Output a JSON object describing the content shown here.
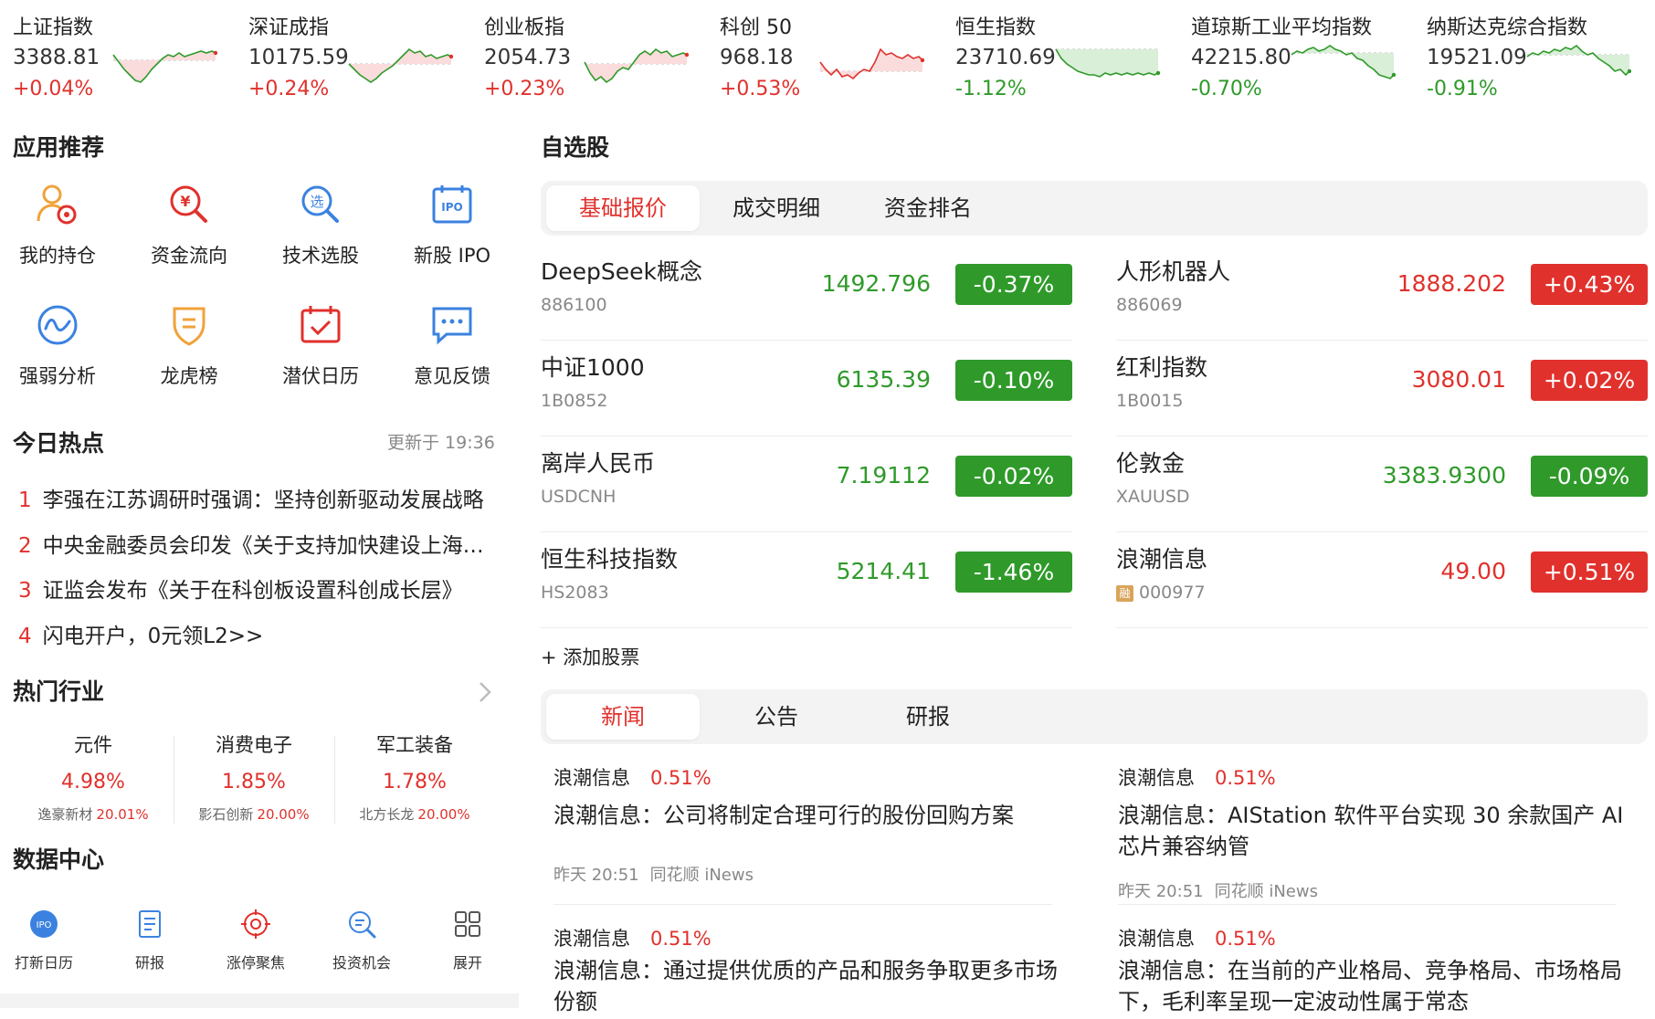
{
  "colors": {
    "up": "#e0312c",
    "down": "#2f9a2a"
  },
  "ticker": [
    {
      "name": "上证指数",
      "price": "3388.81",
      "change": "+0.04%",
      "dir": "up"
    },
    {
      "name": "深证成指",
      "price": "10175.59",
      "change": "+0.24%",
      "dir": "up"
    },
    {
      "name": "创业板指",
      "price": "2054.73",
      "change": "+0.23%",
      "dir": "up"
    },
    {
      "name": "科创 50",
      "price": "968.18",
      "change": "+0.53%",
      "dir": "up"
    },
    {
      "name": "恒生指数",
      "price": "23710.69",
      "change": "-1.12%",
      "dir": "down"
    },
    {
      "name": "道琼斯工业平均指数",
      "price": "42215.80",
      "change": "-0.70%",
      "dir": "down"
    },
    {
      "name": "纳斯达克综合指数",
      "price": "19521.09",
      "change": "-0.91%",
      "dir": "down"
    }
  ],
  "apps": {
    "title": "应用推荐",
    "items": [
      {
        "label": "我的持仓",
        "icon": "portfolio-icon"
      },
      {
        "label": "资金流向",
        "icon": "fund-flow-icon"
      },
      {
        "label": "技术选股",
        "icon": "stock-picker-icon"
      },
      {
        "label": "新股 IPO",
        "icon": "ipo-icon"
      },
      {
        "label": "强弱分析",
        "icon": "strength-analysis-icon"
      },
      {
        "label": "龙虎榜",
        "icon": "dragon-tiger-icon"
      },
      {
        "label": "潜伏日历",
        "icon": "calendar-icon"
      },
      {
        "label": "意见反馈",
        "icon": "feedback-icon"
      }
    ]
  },
  "hot_today": {
    "title": "今日热点",
    "updated": "更新于 19:36",
    "items": [
      {
        "num": "1",
        "text": "李强在江苏调研时强调：坚持创新驱动发展战略"
      },
      {
        "num": "2",
        "text": "中央金融委员会印发《关于支持加快建设上海国际金融中心》"
      },
      {
        "num": "3",
        "text": "证监会发布《关于在科创板设置科创成长层》"
      },
      {
        "num": "4",
        "text": "闪电开户，0元领L2>>"
      }
    ]
  },
  "industries": {
    "title": "热门行业",
    "items": [
      {
        "name": "元件",
        "pct": "4.98%",
        "stock": "逸豪新材",
        "stock_pct": "20.01%"
      },
      {
        "name": "消费电子",
        "pct": "1.85%",
        "stock": "影石创新",
        "stock_pct": "20.00%"
      },
      {
        "name": "军工装备",
        "pct": "1.78%",
        "stock": "北方长龙",
        "stock_pct": "20.00%"
      }
    ]
  },
  "data_center": {
    "title": "数据中心",
    "items": [
      {
        "label": "打新日历",
        "icon": "ipo-calendar-icon"
      },
      {
        "label": "研报",
        "icon": "research-report-icon"
      },
      {
        "label": "涨停聚焦",
        "icon": "limit-up-target-icon"
      },
      {
        "label": "投资机会",
        "icon": "opportunity-search-icon"
      },
      {
        "label": "展开",
        "icon": "expand-grid-icon"
      }
    ]
  },
  "watchlist": {
    "title": "自选股",
    "tabs": [
      "基础报价",
      "成交明细",
      "资金排名"
    ],
    "stocks": [
      {
        "name": "DeepSeek概念",
        "code": "886100",
        "price": "1492.796",
        "change": "-0.37%",
        "dir": "down"
      },
      {
        "name": "人形机器人",
        "code": "886069",
        "price": "1888.202",
        "change": "+0.43%",
        "dir": "up"
      },
      {
        "name": "中证1000",
        "code": "1B0852",
        "price": "6135.39",
        "change": "-0.10%",
        "dir": "down"
      },
      {
        "name": "红利指数",
        "code": "1B0015",
        "price": "3080.01",
        "change": "+0.02%",
        "dir": "up"
      },
      {
        "name": "离岸人民币",
        "code": "USDCNH",
        "price": "7.19112",
        "change": "-0.02%",
        "dir": "down"
      },
      {
        "name": "伦敦金",
        "code": "XAUUSD",
        "price": "3383.9300",
        "change": "-0.09%",
        "dir": "down"
      },
      {
        "name": "恒生科技指数",
        "code": "HS2083",
        "price": "5214.41",
        "change": "-1.46%",
        "dir": "down"
      },
      {
        "name": "浪潮信息",
        "code": "000977",
        "price": "49.00",
        "change": "+0.51%",
        "dir": "up",
        "tag": "融"
      }
    ],
    "add_label": "+ 添加股票"
  },
  "news": {
    "tabs": [
      "新闻",
      "公告",
      "研报"
    ],
    "items": [
      {
        "stock": "浪潮信息",
        "pct": "0.51%",
        "title": "浪潮信息：公司将制定合理可行的股份回购方案",
        "time": "昨天 20:51",
        "source": "同花顺 iNews"
      },
      {
        "stock": "浪潮信息",
        "pct": "0.51%",
        "title": "浪潮信息：AIStation 软件平台实现 30 余款国产 AI 芯片兼容纳管",
        "time": "昨天 20:51",
        "source": "同花顺 iNews"
      },
      {
        "stock": "浪潮信息",
        "pct": "0.51%",
        "title": "浪潮信息：通过提供优质的产品和服务争取更多市场份额",
        "time": "",
        "source": ""
      },
      {
        "stock": "浪潮信息",
        "pct": "0.51%",
        "title": "浪潮信息：在当前的产业格局、竞争格局、市场格局下，毛利率呈现一定波动性属于常态",
        "time": "",
        "source": ""
      }
    ]
  }
}
